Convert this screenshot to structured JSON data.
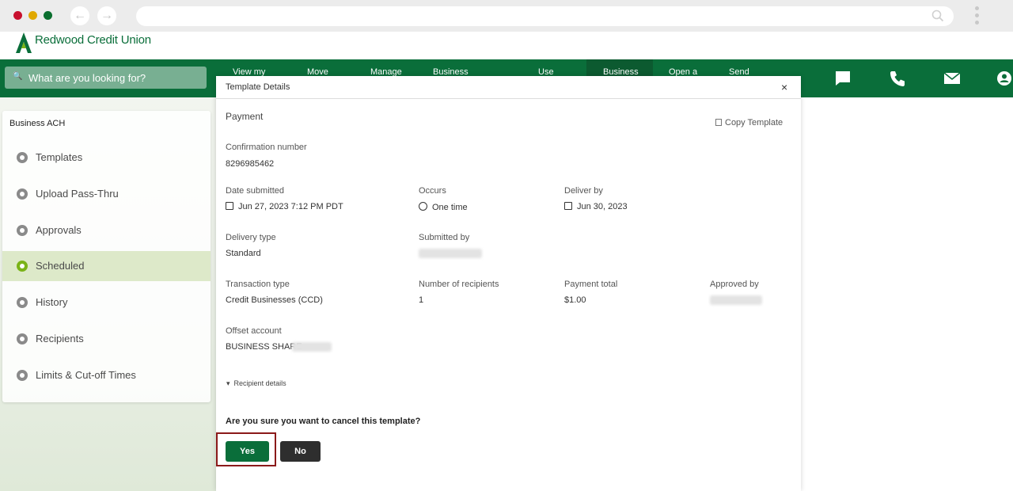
{
  "site": {
    "logo_text": "Redwood Credit Union",
    "search_placeholder": "What are you looking for?"
  },
  "nav": {
    "items": [
      "View my",
      "Move",
      "Manage",
      "Business",
      "Use",
      "Business",
      "Open a",
      "Send"
    ],
    "active_index": 5
  },
  "sidebar": {
    "title": "Business ACH",
    "items": [
      {
        "label": "Templates"
      },
      {
        "label": "Upload Pass-Thru"
      },
      {
        "label": "Approvals"
      },
      {
        "label": "Scheduled"
      },
      {
        "label": "History"
      },
      {
        "label": "Recipients"
      },
      {
        "label": "Limits & Cut-off Times"
      }
    ],
    "active_index": 3
  },
  "modal": {
    "title": "Template Details",
    "close_glyph": "×",
    "section_title": "Payment",
    "copy_template_label": "Copy Template",
    "fields": {
      "confirmation_label": "Confirmation number",
      "confirmation_value": "8296985462",
      "date_submitted_label": "Date submitted",
      "date_submitted_value": "Jun 27, 2023 7:12 PM PDT",
      "occurs_label": "Occurs",
      "occurs_value": "One time",
      "deliver_by_label": "Deliver by",
      "deliver_by_value": "Jun 30, 2023",
      "delivery_type_label": "Delivery type",
      "delivery_type_value": "Standard",
      "submitted_by_label": "Submitted by",
      "transaction_type_label": "Transaction type",
      "transaction_type_value": "Credit Businesses (CCD)",
      "num_recipients_label": "Number of recipients",
      "num_recipients_value": "1",
      "payment_total_label": "Payment total",
      "payment_total_value": "$1.00",
      "approved_by_label": "Approved by",
      "offset_account_label": "Offset account",
      "offset_account_value": "BUSINESS SHARE"
    },
    "recipient_details_label": "Recipient details",
    "confirm_question": "Are you sure you want to cancel this template?",
    "yes_label": "Yes",
    "no_label": "No"
  },
  "colors": {
    "brand_green": "#0a6e3a",
    "active_nav_bg": "#0c5a30",
    "sidebar_active_bg": "#dde9c9",
    "sidebar_active_icon": "#7ab317",
    "highlight_border": "#8b1a1a",
    "no_button": "#2e2e2e"
  }
}
